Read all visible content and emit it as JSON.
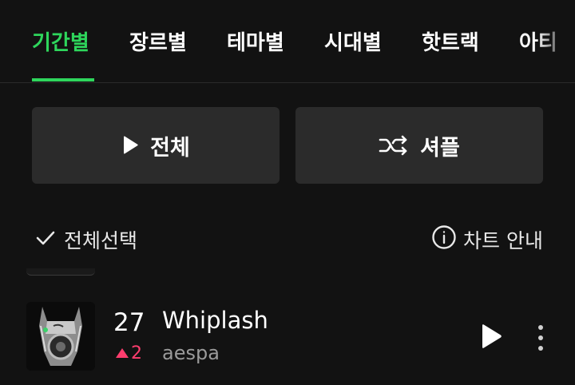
{
  "tabs": [
    {
      "label": "기간별",
      "active": true
    },
    {
      "label": "장르별",
      "active": false
    },
    {
      "label": "테마별",
      "active": false
    },
    {
      "label": "시대별",
      "active": false
    },
    {
      "label": "핫트랙",
      "active": false
    },
    {
      "label": "아티",
      "active": false
    }
  ],
  "actions": {
    "play_all_label": "전체",
    "shuffle_label": "셔플"
  },
  "list_header": {
    "select_all_label": "전체선택",
    "chart_info_label": "차트 안내"
  },
  "tracks": [
    {
      "rank": "27",
      "change": "2",
      "change_direction": "up",
      "title": "Whiplash",
      "artist": "aespa"
    }
  ],
  "colors": {
    "accent": "#2ed65c",
    "rise": "#ff3d6e",
    "background": "#121212",
    "button_bg": "#2b2b2b"
  },
  "icons": {
    "play": "play-icon",
    "shuffle": "shuffle-icon",
    "check": "check-icon",
    "info": "info-icon",
    "more": "more-vertical-icon"
  }
}
